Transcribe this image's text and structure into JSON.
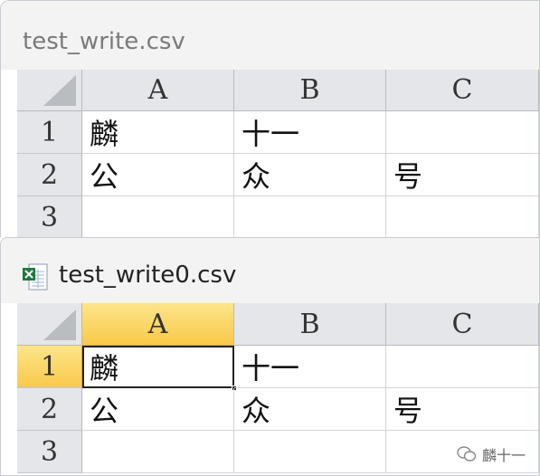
{
  "windows": [
    {
      "title": "test_write.csv",
      "columns": [
        "A",
        "B",
        "C"
      ],
      "rows": [
        {
          "num": "1",
          "cells": [
            "麟",
            "十一",
            ""
          ]
        },
        {
          "num": "2",
          "cells": [
            "公",
            "众",
            "号"
          ]
        },
        {
          "num": "3",
          "cells": [
            "",
            "",
            ""
          ]
        }
      ]
    },
    {
      "title": "test_write0.csv",
      "icon": "excel-csv-file-icon",
      "columns": [
        "A",
        "B",
        "C"
      ],
      "selected_column": "A",
      "selected_row": "1",
      "rows": [
        {
          "num": "1",
          "cells": [
            "麟",
            "十一",
            ""
          ]
        },
        {
          "num": "2",
          "cells": [
            "公",
            "众",
            "号"
          ]
        },
        {
          "num": "3",
          "cells": [
            "",
            "",
            ""
          ]
        }
      ]
    }
  ],
  "watermark": {
    "icon": "wechat-icon",
    "text": "麟十一"
  },
  "colors": {
    "selection_header": "#f9c94a",
    "header_bg": "#e4e6ea",
    "grid_line": "#d4d4d4"
  }
}
